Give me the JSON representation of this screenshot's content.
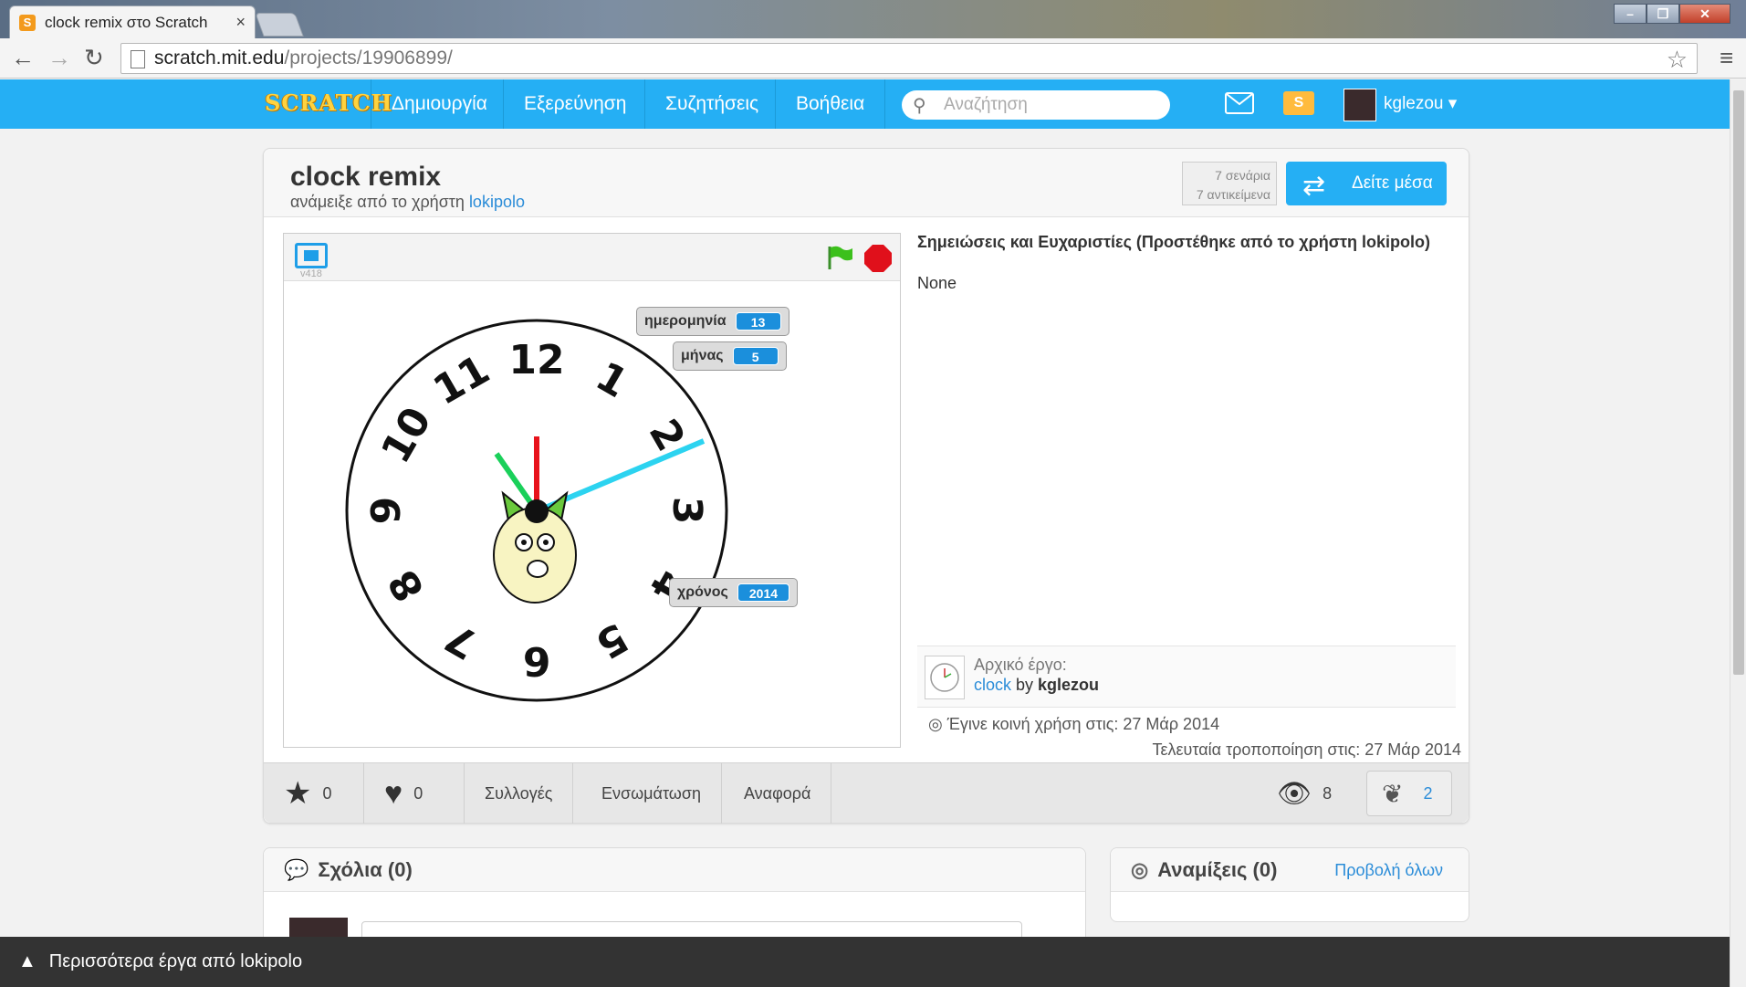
{
  "browser": {
    "tab_title": "clock remix στο Scratch",
    "tab_close": "×",
    "url_domain": "scratch.mit.edu",
    "url_path": "/projects/19906899/"
  },
  "nav": {
    "logo": "SCRATCH",
    "items": [
      "Δημιουργία",
      "Εξερεύνηση",
      "Συζητήσεις",
      "Βοήθεια"
    ],
    "search_placeholder": "Αναζήτηση",
    "username": "kglezou ▾"
  },
  "project": {
    "title": "clock remix",
    "remixed_by_prefix": "ανάμειξε από το χρήστη ",
    "remixed_by_user": "lokipolo",
    "scripts_count": "7 σενάρια",
    "sprites_count": "7 αντικείμενα",
    "see_inside": "Δείτε μέσα",
    "player_version": "v418",
    "monitors": [
      {
        "label": "ημερομηνία",
        "value": "13"
      },
      {
        "label": "μήνας",
        "value": "5"
      },
      {
        "label": "χρόνος",
        "value": "2014"
      }
    ],
    "clock_numbers": [
      "12",
      "1",
      "2",
      "3",
      "4",
      "5",
      "6",
      "7",
      "8",
      "9",
      "10",
      "11"
    ],
    "notes_title": "Σημειώσεις και Ευχαριστίες (Προστέθηκε από το χρήστη lokipolo)",
    "notes_body": "None",
    "original_label": "Αρχικό έργο:",
    "original_project": "clock",
    "original_by": " by ",
    "original_author": "kglezou",
    "shared_date": "Έγινε κοινή χρήση στις: 27 Μάρ 2014",
    "modified_date": "Τελευταία τροποποίηση στις: 27 Μάρ 2014"
  },
  "actions": {
    "favorites": "0",
    "loves": "0",
    "collections": "Συλλογές",
    "embed": "Ενσωμάτωση",
    "report": "Αναφορά",
    "views": "8",
    "remixes": "2"
  },
  "comments": {
    "title": "Σχόλια (0)"
  },
  "remixes_box": {
    "title": "Αναμίξεις (0)",
    "view_all": "Προβολή όλων"
  },
  "bottom_bar": {
    "label": "Περισσότερα έργα από lokipolo"
  },
  "colors": {
    "scratch_blue": "#25aff4",
    "link_blue": "#2a8cd8",
    "monitor_value": "#1b8fdc"
  }
}
